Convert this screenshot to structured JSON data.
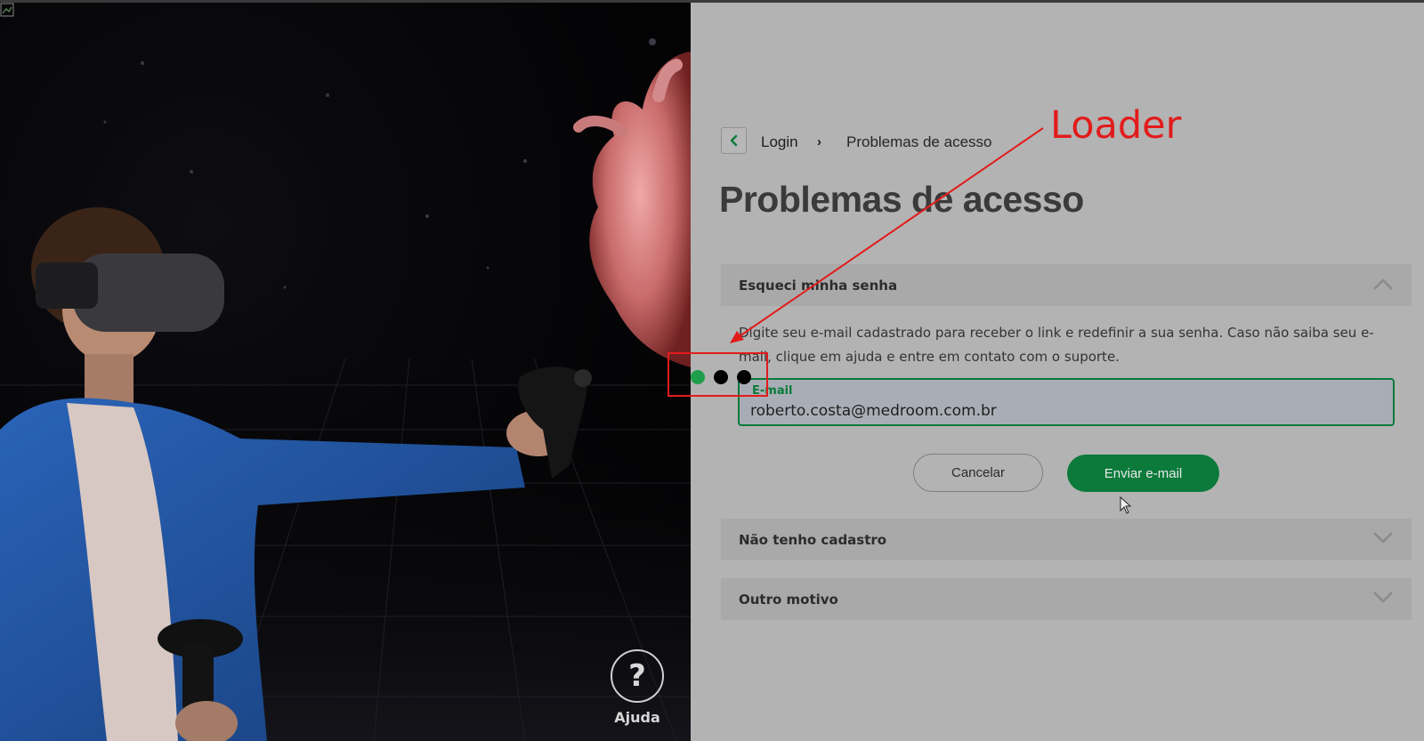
{
  "left": {
    "help_label": "Ajuda",
    "help_glyph": "?"
  },
  "breadcrumb": {
    "back_icon": "chevron-left-icon",
    "login": "Login",
    "separator": "›",
    "current": "Problemas de acesso"
  },
  "page": {
    "title": "Problemas de acesso"
  },
  "accordion": [
    {
      "title": "Esqueci minha senha",
      "expanded": true,
      "description": "Digite seu e-mail cadastrado para receber o link e redefinir a sua senha. Caso não saiba seu e-mail, clique em ajuda e entre em contato com o suporte.",
      "email_label": "E-mail",
      "email_value": "roberto.costa@medroom.com.br",
      "cancel_label": "Cancelar",
      "send_label": "Enviar e-mail"
    },
    {
      "title": "Não tenho cadastro",
      "expanded": false
    },
    {
      "title": "Outro motivo",
      "expanded": false
    }
  ],
  "loader": {
    "dots": 3,
    "active_index": 0
  },
  "annotation": {
    "label": "Loader",
    "color": "#e21b1b"
  },
  "colors": {
    "accent": "#0b7a3a",
    "overlay_dim": "#b3b3b3"
  }
}
